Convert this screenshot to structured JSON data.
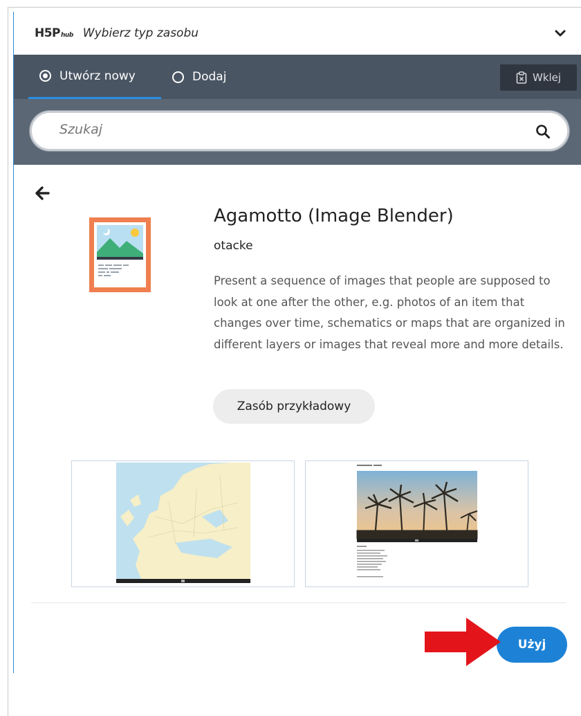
{
  "header": {
    "logo_main": "H5P",
    "logo_sub": "hub",
    "title": "Wybierz typ zasobu"
  },
  "tabs": [
    {
      "label": "Utwórz nowy",
      "selected": true
    },
    {
      "label": "Dodaj",
      "selected": false
    }
  ],
  "toolbar": {
    "paste_label": "Wklej"
  },
  "search": {
    "placeholder": "Szukaj"
  },
  "detail": {
    "title": "Agamotto (Image Blender)",
    "owner": "otacke",
    "description": "Present a sequence of images that people are supposed to look at one after the other, e.g. photos of an item that changes over time, schematics or maps that are organized in different layers or images that reveal more and more details.",
    "demo_label": "Zasób przykładowy",
    "use_label": "Użyj"
  },
  "colors": {
    "accent": "#1d82d6",
    "tabbar": "#4a5563",
    "searchbar": "#5c6775",
    "icon_frame": "#f07f4f",
    "annotation_arrow": "#e3151b"
  },
  "icons": [
    "chevron-down-icon",
    "radio-icon",
    "clipboard-icon",
    "search-icon",
    "back-arrow-icon",
    "content-type-icon"
  ]
}
